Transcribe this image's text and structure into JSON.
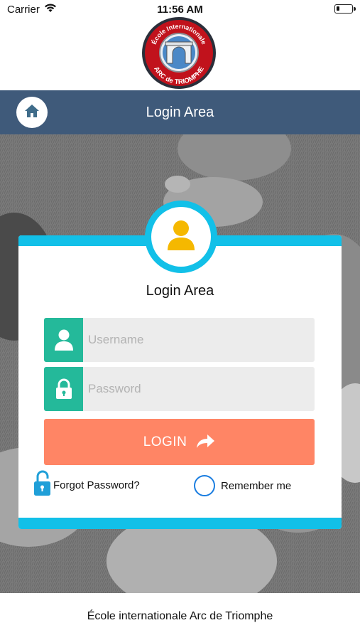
{
  "status_bar": {
    "carrier": "Carrier",
    "time": "11:56 AM"
  },
  "logo": {
    "text_top": "École Internationale",
    "text_bottom": "ARC de TRIOMPHE"
  },
  "header": {
    "title": "Login Area",
    "home_icon": "home-icon"
  },
  "card": {
    "title": "Login Area",
    "avatar_icon": "user-icon",
    "username": {
      "placeholder": "Username",
      "value": "",
      "icon": "user-icon"
    },
    "password": {
      "placeholder": "Password",
      "value": "",
      "icon": "lock-icon"
    },
    "login_label": "LOGIN",
    "login_icon": "share-arrow-icon",
    "forgot_label": "Forgot Password?",
    "forgot_icon": "unlock-icon",
    "remember_label": "Remember me",
    "remember_checked": false
  },
  "footer": {
    "text": "École internationale Arc de Triomphe"
  },
  "colors": {
    "header": "#3f5a7a",
    "accent_cyan": "#12c0e8",
    "field_icon": "#24b99a",
    "login_button": "#ff8565",
    "avatar": "#f5b800",
    "radio": "#1a7de0"
  }
}
